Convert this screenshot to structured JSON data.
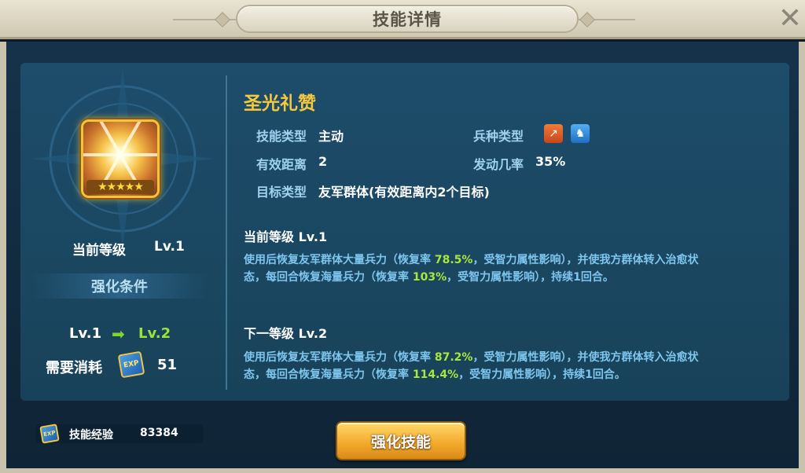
{
  "header": {
    "title": "技能详情",
    "close_icon": "close-icon"
  },
  "skill": {
    "name": "圣光礼赞",
    "icon": "holy-light-skill-icon",
    "stars": "★★★★★",
    "star_count": 5
  },
  "left": {
    "current_level_label": "当前等级",
    "current_level_value": "Lv.1",
    "condition_title": "强化条件",
    "from_level": "Lv.1",
    "to_level": "Lv.2",
    "cost_label": "需要消耗",
    "cost_icon": "exp-book-icon",
    "cost_value": "51"
  },
  "attributes": {
    "type_label": "技能类型",
    "type_value": "主动",
    "troop_label": "兵种类型",
    "troop_icons": [
      "spear-icon",
      "cavalry-icon"
    ],
    "range_label": "有效距离",
    "range_value": "2",
    "chance_label": "发动几率",
    "chance_value": "35%",
    "target_label": "目标类型",
    "target_value": "友军群体(有效距离内2个目标)"
  },
  "current": {
    "heading": "当前等级  Lv.1",
    "desc_a": "使用后恢复友军群体大量兵力（恢复率 ",
    "rate1": "78.5%",
    "desc_b": "，受智力属性影响），并使我方群体转入治愈状态，每回合恢复海量兵力（恢复率 ",
    "rate2": "103%",
    "desc_c": "，受智力属性影响），持续1回合。"
  },
  "next": {
    "heading": "下一等级  Lv.2",
    "desc_a": "使用后恢复友军群体大量兵力（恢复率 ",
    "rate1": "87.2%",
    "desc_b": "，受智力属性影响），并使我方群体转入治愈状态，每回合恢复海量兵力（恢复率 ",
    "rate2": "114.4%",
    "desc_c": "，受智力属性影响），持续1回合。"
  },
  "footer": {
    "exp_icon": "exp-book-icon",
    "exp_label": "技能经验",
    "exp_value": "83384",
    "upgrade_button": "强化技能"
  },
  "colors": {
    "accent_gold": "#f6c83c",
    "highlight_green": "#a8e83c",
    "label_blue": "#9fd2ee",
    "panel_blue": "#1d4d6b"
  }
}
